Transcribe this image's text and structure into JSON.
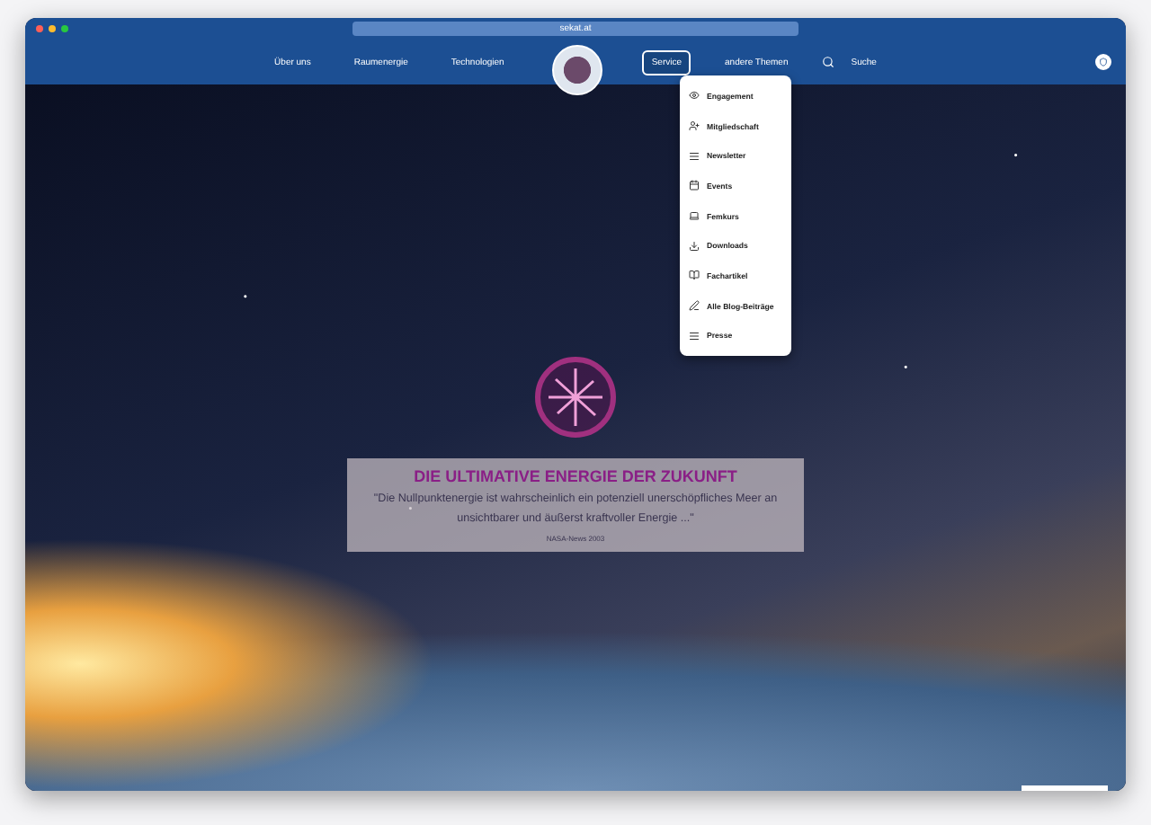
{
  "browser": {
    "url": "sekat.at"
  },
  "nav": {
    "items": [
      {
        "label": "Über uns",
        "selected": false
      },
      {
        "label": "Raumenergie",
        "selected": false
      },
      {
        "label": "Technologien",
        "selected": false
      },
      {
        "label": "Service",
        "selected": true
      },
      {
        "label": "andere Themen",
        "selected": false
      }
    ],
    "search": "Suche"
  },
  "menu": [
    {
      "label": "Engagement",
      "kind": "eye"
    },
    {
      "label": "Mitgliedschaft",
      "kind": "user"
    },
    {
      "label": "Newsletter",
      "kind": "lines"
    },
    {
      "label": "Events",
      "kind": "calendar"
    },
    {
      "label": "Femkurs",
      "kind": "laptop"
    },
    {
      "label": "Downloads",
      "kind": "download"
    },
    {
      "label": "Fachartikel",
      "kind": "book"
    },
    {
      "label": "Alle Blog-Beiträge",
      "kind": "pen"
    },
    {
      "label": "Presse",
      "kind": "lines"
    }
  ],
  "hero": {
    "title": "DIE ULTIMATIVE ENERGIE DER ZUKUNFT",
    "quote": "\"Die Nullpunktenergie ist wahrscheinlich ein potenziell unerschöpfliches Meer an unsichtbarer und äußerst kraftvoller Energie ...\"",
    "source": "NASA-News 2003"
  }
}
